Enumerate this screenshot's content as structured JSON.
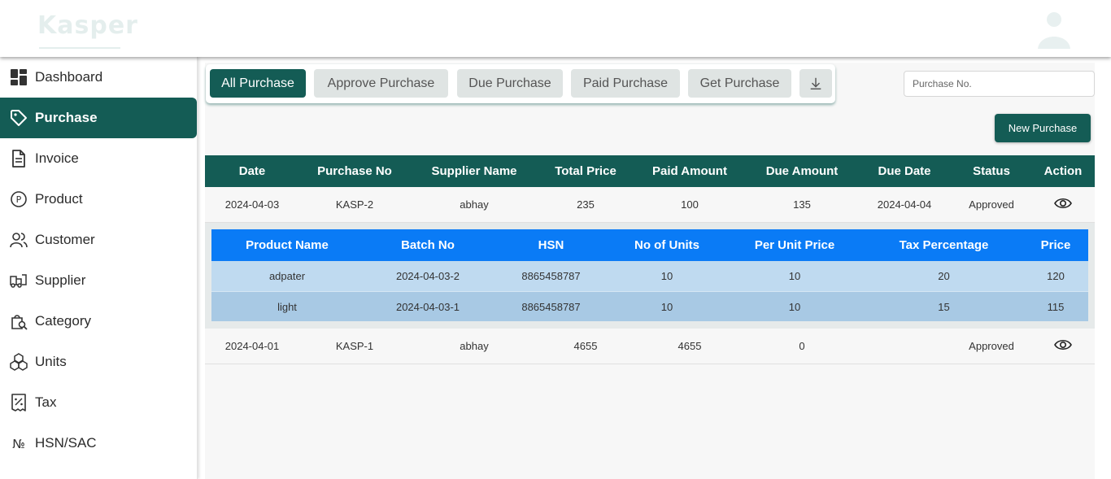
{
  "header": {
    "logo_text": "Kasper"
  },
  "sidebar": {
    "items": [
      {
        "label": "Dashboard",
        "icon": "dashboard-icon"
      },
      {
        "label": "Purchase",
        "icon": "tag-icon",
        "active": true
      },
      {
        "label": "Invoice",
        "icon": "document-icon"
      },
      {
        "label": "Product",
        "icon": "product-p-icon"
      },
      {
        "label": "Customer",
        "icon": "users-icon"
      },
      {
        "label": "Supplier",
        "icon": "truck-icon"
      },
      {
        "label": "Category",
        "icon": "bag-search-icon"
      },
      {
        "label": "Units",
        "icon": "cubes-icon"
      },
      {
        "label": "Tax",
        "icon": "receipt-percent-icon"
      },
      {
        "label": "HSN/SAC",
        "icon": "numero-icon"
      }
    ]
  },
  "tabs": [
    {
      "label": "All Purchase",
      "active": true
    },
    {
      "label": "Approve Purchase"
    },
    {
      "label": "Due Purchase"
    },
    {
      "label": "Paid Purchase"
    },
    {
      "label": "Get Purchase"
    }
  ],
  "download_icon": "download-icon",
  "search": {
    "placeholder": "Purchase No.",
    "value": ""
  },
  "new_purchase_label": "New Purchase",
  "purchase_table": {
    "columns": [
      "Date",
      "Purchase No",
      "Supplier Name",
      "Total Price",
      "Paid Amount",
      "Due Amount",
      "Due Date",
      "Status",
      "Action"
    ],
    "rows": [
      {
        "date": "2024-04-03",
        "purchase_no": "KASP-2",
        "supplier": "abhay",
        "total": "235",
        "paid": "100",
        "due": "135",
        "due_date": "2024-04-04",
        "status": "Approved"
      },
      {
        "date": "2024-04-01",
        "purchase_no": "KASP-1",
        "supplier": "abhay",
        "total": "4655",
        "paid": "4655",
        "due": "0",
        "due_date": "",
        "status": "Approved"
      }
    ]
  },
  "detail_table": {
    "columns": [
      "Product Name",
      "Batch No",
      "HSN",
      "No of Units",
      "Per Unit Price",
      "Tax Percentage",
      "Price"
    ],
    "rows": [
      {
        "product": "adpater",
        "batch": "2024-04-03-2",
        "hsn": "8865458787",
        "units": "10",
        "unit_price": "10",
        "tax": "20",
        "price": "120"
      },
      {
        "product": "light",
        "batch": "2024-04-03-1",
        "hsn": "8865458787",
        "units": "10",
        "unit_price": "10",
        "tax": "15",
        "price": "115"
      }
    ]
  },
  "colors": {
    "primary": "#145c55",
    "detail_header": "#0a7bf6",
    "status_approved": "#2e7d32"
  }
}
